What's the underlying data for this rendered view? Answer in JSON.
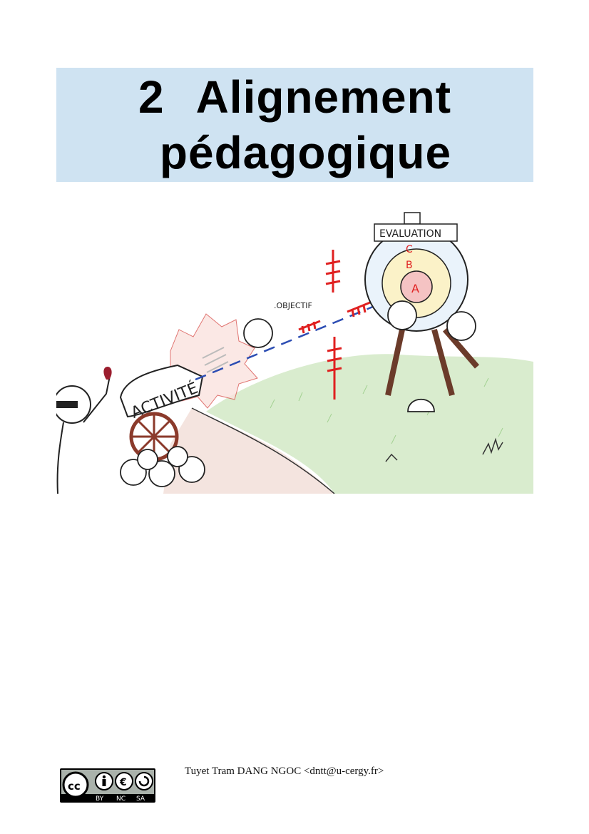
{
  "header": {
    "chapter_number": "2",
    "title_line1": "Alignement",
    "title_line2": "pédagogique"
  },
  "illustration": {
    "sign_text": "EVALUATION",
    "cannon_text": "ACTIVITÉ",
    "objective_text": ".OBJECTIF",
    "ring_a": "A",
    "ring_b": "B",
    "ring_c": "C"
  },
  "footer": {
    "author": "Tuyet Tram DANG NGOC <dntt@u-cergy.fr>",
    "license_labels": [
      "BY",
      "NC",
      "SA"
    ],
    "license_badge": "cc"
  }
}
